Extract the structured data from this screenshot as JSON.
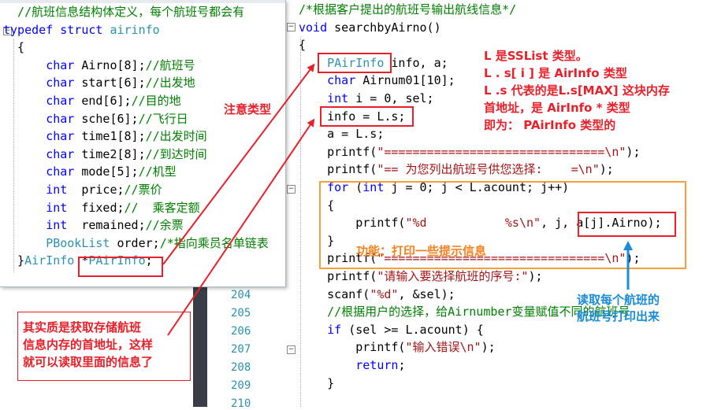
{
  "right_editor": {
    "line_numbers": [
      "204",
      "205",
      "206",
      "207",
      "208",
      "209",
      "210"
    ],
    "lines": [
      {
        "parts": [
          {
            "c": "cm",
            "t": "/*根据客户提出的航班号输出航线信息*/"
          }
        ]
      },
      {
        "parts": [
          {
            "c": "kw",
            "t": "void"
          },
          {
            "c": "tx",
            "t": " searchbyAirno()"
          }
        ]
      },
      {
        "parts": [
          {
            "c": "tx",
            "t": "{"
          }
        ]
      },
      {
        "parts": [
          {
            "c": "tx",
            "t": "    "
          },
          {
            "c": "ty",
            "t": "PAirInfo"
          },
          {
            "c": "tx",
            "t": " info, a;"
          }
        ]
      },
      {
        "parts": [
          {
            "c": "tx",
            "t": "    "
          },
          {
            "c": "kw",
            "t": "char"
          },
          {
            "c": "tx",
            "t": " Airnum01[10];"
          }
        ]
      },
      {
        "parts": [
          {
            "c": "tx",
            "t": "    "
          },
          {
            "c": "kw",
            "t": "int"
          },
          {
            "c": "tx",
            "t": " i = 0, sel;"
          }
        ]
      },
      {
        "parts": [
          {
            "c": "tx",
            "t": "    info = L.s;"
          }
        ]
      },
      {
        "parts": [
          {
            "c": "tx",
            "t": "    a = L.s;"
          }
        ]
      },
      {
        "parts": [
          {
            "c": "tx",
            "t": "    printf("
          },
          {
            "c": "st",
            "t": "\"===============================\\n\""
          },
          {
            "c": "tx",
            "t": ");"
          }
        ]
      },
      {
        "parts": [
          {
            "c": "tx",
            "t": "    printf("
          },
          {
            "c": "st",
            "t": "\"== 为您列出航班号供您选择:    =\\n\""
          },
          {
            "c": "tx",
            "t": ");"
          }
        ]
      },
      {
        "parts": [
          {
            "c": "tx",
            "t": "    "
          },
          {
            "c": "kw",
            "t": "for"
          },
          {
            "c": "tx",
            "t": " ("
          },
          {
            "c": "kw",
            "t": "int"
          },
          {
            "c": "tx",
            "t": " j = 0; j < L.acount; j++)"
          }
        ]
      },
      {
        "parts": [
          {
            "c": "tx",
            "t": "    {"
          }
        ]
      },
      {
        "parts": [
          {
            "c": "tx",
            "t": "        printf("
          },
          {
            "c": "st",
            "t": "\"%d           %s\\n\""
          },
          {
            "c": "tx",
            "t": ", j, a[j].Airno);"
          }
        ]
      },
      {
        "parts": [
          {
            "c": "tx",
            "t": "    }"
          }
        ]
      },
      {
        "parts": [
          {
            "c": "tx",
            "t": "    printf("
          },
          {
            "c": "st",
            "t": "\"===============================\\n\""
          },
          {
            "c": "tx",
            "t": ");"
          }
        ]
      },
      {
        "parts": [
          {
            "c": "tx",
            "t": "    printf("
          },
          {
            "c": "st",
            "t": "\"请输入要选择航班的序号:\""
          },
          {
            "c": "tx",
            "t": ");"
          }
        ]
      },
      {
        "parts": [
          {
            "c": "tx",
            "t": "    scanf("
          },
          {
            "c": "st",
            "t": "\"%d\""
          },
          {
            "c": "tx",
            "t": ", &sel);"
          }
        ]
      },
      {
        "parts": [
          {
            "c": "tx",
            "t": "    "
          },
          {
            "c": "cm",
            "t": "//根据用户的选择，给Airnumber变量赋值不同的航班号"
          }
        ]
      },
      {
        "parts": [
          {
            "c": "tx",
            "t": "    "
          },
          {
            "c": "kw",
            "t": "if"
          },
          {
            "c": "tx",
            "t": " (sel >= L.acount) {"
          }
        ]
      },
      {
        "parts": [
          {
            "c": "tx",
            "t": "        printf("
          },
          {
            "c": "st",
            "t": "\"输入错误\\n\""
          },
          {
            "c": "tx",
            "t": ");"
          }
        ]
      },
      {
        "parts": [
          {
            "c": "tx",
            "t": "        "
          },
          {
            "c": "kw",
            "t": "return"
          },
          {
            "c": "tx",
            "t": ";"
          }
        ]
      },
      {
        "parts": [
          {
            "c": "tx",
            "t": "    }"
          }
        ]
      }
    ]
  },
  "left_popup": {
    "lines": [
      {
        "parts": [
          {
            "c": "cm",
            "t": "  //航班信息结构体定义，每个航班号都会有"
          }
        ]
      },
      {
        "parts": [
          {
            "c": "kw",
            "t": "typedef"
          },
          {
            "c": "tx",
            "t": " "
          },
          {
            "c": "kw",
            "t": "struct"
          },
          {
            "c": "tx",
            "t": " "
          },
          {
            "c": "ty",
            "t": "airinfo"
          }
        ]
      },
      {
        "parts": [
          {
            "c": "tx",
            "t": "  {"
          }
        ]
      },
      {
        "parts": [
          {
            "c": "tx",
            "t": "      "
          },
          {
            "c": "kw",
            "t": "char"
          },
          {
            "c": "tx",
            "t": " Airno[8];"
          },
          {
            "c": "cm",
            "t": "//航班号"
          }
        ]
      },
      {
        "parts": [
          {
            "c": "tx",
            "t": "      "
          },
          {
            "c": "kw",
            "t": "char"
          },
          {
            "c": "tx",
            "t": " start[6];"
          },
          {
            "c": "cm",
            "t": "//出发地"
          }
        ]
      },
      {
        "parts": [
          {
            "c": "tx",
            "t": "      "
          },
          {
            "c": "kw",
            "t": "char"
          },
          {
            "c": "tx",
            "t": " end[6];"
          },
          {
            "c": "cm",
            "t": "//目的地"
          }
        ]
      },
      {
        "parts": [
          {
            "c": "tx",
            "t": "      "
          },
          {
            "c": "kw",
            "t": "char"
          },
          {
            "c": "tx",
            "t": " sche[6];"
          },
          {
            "c": "cm",
            "t": "//飞行日"
          }
        ]
      },
      {
        "parts": [
          {
            "c": "tx",
            "t": "      "
          },
          {
            "c": "kw",
            "t": "char"
          },
          {
            "c": "tx",
            "t": " time1[8];"
          },
          {
            "c": "cm",
            "t": "//出发时间"
          }
        ]
      },
      {
        "parts": [
          {
            "c": "tx",
            "t": "      "
          },
          {
            "c": "kw",
            "t": "char"
          },
          {
            "c": "tx",
            "t": " time2[8];"
          },
          {
            "c": "cm",
            "t": "//到达时间"
          }
        ]
      },
      {
        "parts": [
          {
            "c": "tx",
            "t": "      "
          },
          {
            "c": "kw",
            "t": "char"
          },
          {
            "c": "tx",
            "t": " mode[5];"
          },
          {
            "c": "cm",
            "t": "//机型"
          }
        ]
      },
      {
        "parts": [
          {
            "c": "tx",
            "t": "      "
          },
          {
            "c": "kw",
            "t": "int"
          },
          {
            "c": "tx",
            "t": "  price;"
          },
          {
            "c": "cm",
            "t": "//票价"
          }
        ]
      },
      {
        "parts": [
          {
            "c": "tx",
            "t": "      "
          },
          {
            "c": "kw",
            "t": "int"
          },
          {
            "c": "tx",
            "t": "  fixed;"
          },
          {
            "c": "cm",
            "t": "//  乘客定额"
          }
        ]
      },
      {
        "parts": [
          {
            "c": "tx",
            "t": "      "
          },
          {
            "c": "kw",
            "t": "int"
          },
          {
            "c": "tx",
            "t": "  remained;"
          },
          {
            "c": "cm",
            "t": "//余票"
          }
        ]
      },
      {
        "parts": [
          {
            "c": "tx",
            "t": "      "
          },
          {
            "c": "ty",
            "t": "PBookList"
          },
          {
            "c": "tx",
            "t": " order;"
          },
          {
            "c": "cm",
            "t": "/*指向乘员名单链表"
          }
        ]
      },
      {
        "parts": [
          {
            "c": "tx",
            "t": "  }"
          },
          {
            "c": "ty",
            "t": "AirInfo"
          },
          {
            "c": "tx",
            "t": " *"
          },
          {
            "c": "ty",
            "t": "PAirInfo"
          },
          {
            "c": "tx",
            "t": ";"
          }
        ]
      }
    ]
  },
  "annotations": {
    "note_type_lines": [
      "L 是SSList 类型。",
      "L . s[ i ] 是 AirInfo 类型",
      "L .s 代表的是L.s[MAX] 这块内存",
      "首地址，是   AirInfo * 类型",
      "即为： PAirInfo 类型的"
    ],
    "note_attention": "注意类型",
    "note_function": "功能：打印一些提示信息",
    "note_read_lines": [
      "读取每个航班的",
      "航班号打印出来"
    ],
    "note_essence_lines": [
      "其实质是获取存储航班",
      "信息内存的首地址，这样",
      "就可以读取里面的信息了"
    ],
    "fold_minus": "−",
    "colors": {
      "red": "#e8202a",
      "orange": "#f5a03c",
      "blue": "#1a8cd8",
      "keyword": "#0000ff",
      "type": "#2b91af",
      "comment": "#008000",
      "string": "#a31515"
    }
  }
}
